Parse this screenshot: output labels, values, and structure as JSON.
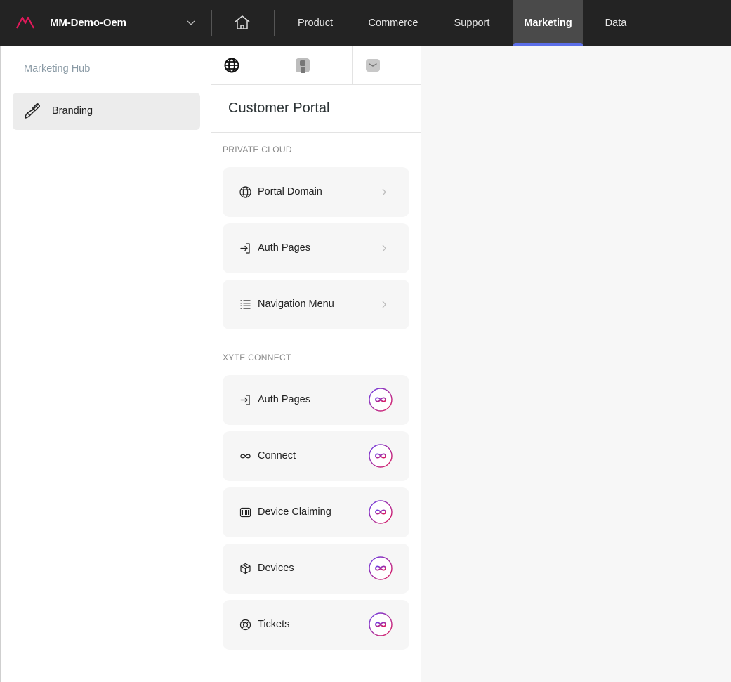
{
  "header": {
    "org_name": "MM-Demo-Oem",
    "nav_tabs": [
      {
        "label": "Product"
      },
      {
        "label": "Commerce"
      },
      {
        "label": "Support"
      },
      {
        "label": "Marketing",
        "active": true
      },
      {
        "label": "Data"
      }
    ],
    "logo_icon": "av-logo",
    "home_icon": "home-icon",
    "accent_color": "#5b6ee8",
    "brand_color": "#e0195a"
  },
  "sidebar": {
    "heading": "Marketing Hub",
    "items": [
      {
        "label": "Branding",
        "icon": "brush-icon",
        "selected": true
      }
    ]
  },
  "panel": {
    "tabs": [
      {
        "icon": "globe-icon",
        "active": true
      },
      {
        "icon": "user-tab-icon"
      },
      {
        "icon": "mail-tab-icon"
      }
    ],
    "title": "Customer Portal",
    "sections": [
      {
        "label": "PRIVATE CLOUD",
        "items": [
          {
            "label": "Portal Domain",
            "icon": "globe-icon"
          },
          {
            "label": "Auth Pages",
            "icon": "login-icon"
          },
          {
            "label": "Navigation Menu",
            "icon": "list-icon"
          }
        ]
      },
      {
        "label": "XYTE CONNECT",
        "items": [
          {
            "label": "Auth Pages",
            "icon": "login-icon"
          },
          {
            "label": "Connect",
            "icon": "infinity-icon"
          },
          {
            "label": "Device Claiming",
            "icon": "barcode-icon"
          },
          {
            "label": "Devices",
            "icon": "box-icon"
          },
          {
            "label": "Tickets",
            "icon": "lifebuoy-icon"
          }
        ]
      }
    ]
  }
}
